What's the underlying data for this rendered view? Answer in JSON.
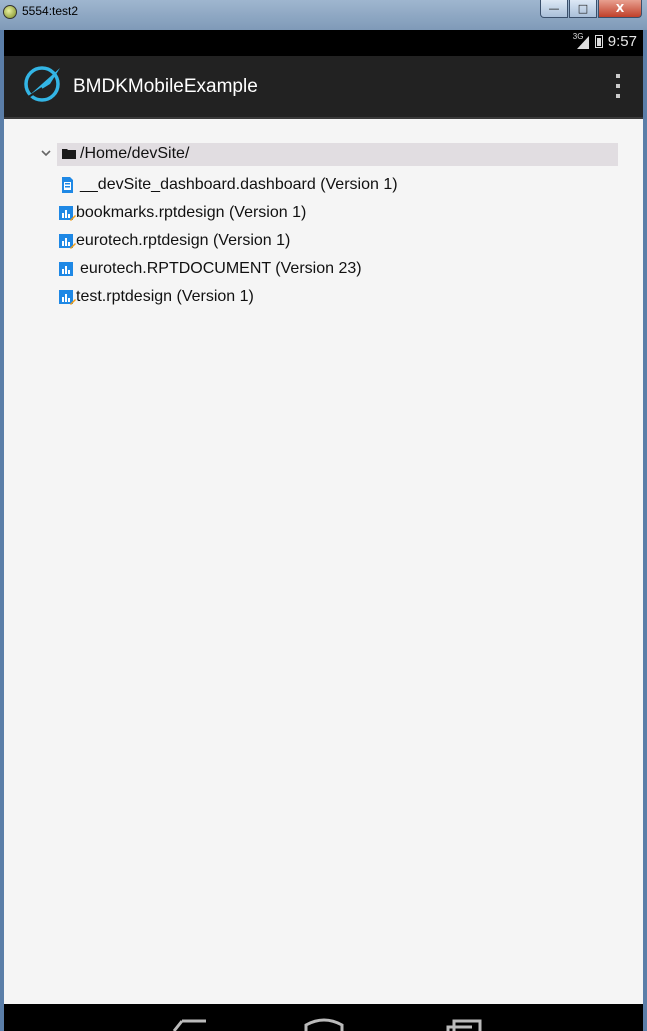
{
  "window": {
    "title": "5554:test2"
  },
  "status_bar": {
    "network": "3G",
    "time": "9:57"
  },
  "action_bar": {
    "title": "BMDKMobileExample"
  },
  "tree": {
    "root": "/Home/devSite/",
    "items": [
      {
        "label": "__devSite_dashboard.dashboard (Version 1)",
        "icon": "dashboard-file-icon"
      },
      {
        "label": "bookmarks.rptdesign (Version 1)",
        "icon": "report-design-icon"
      },
      {
        "label": "eurotech.rptdesign (Version 1)",
        "icon": "report-design-icon"
      },
      {
        "label": "eurotech.RPTDOCUMENT (Version 23)",
        "icon": "report-document-icon"
      },
      {
        "label": "test.rptdesign (Version 1)",
        "icon": "report-design-icon"
      }
    ]
  },
  "colors": {
    "action_bar": "#222222",
    "accent": "#33b5e5",
    "selection": "#e1dde1"
  }
}
